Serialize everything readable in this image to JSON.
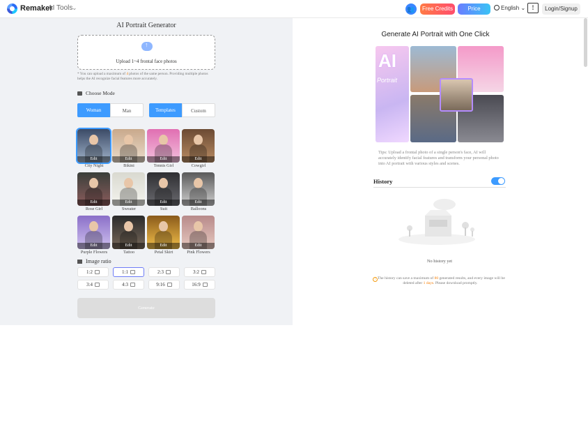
{
  "header": {
    "brand": "Remaker",
    "ai_tools": "AI Tools",
    "free_credits": "Free Credits",
    "price": "Price",
    "language": "English",
    "login": "Login/Signup"
  },
  "left": {
    "title": "AI Portrait Generator",
    "upload_text": "Upload 1~4 frontal face photos",
    "upload_note_prefix": "* You can upload a maximum of ",
    "upload_note_count": "4",
    "upload_note_suffix": " photos of the same person. Providing multiple photos helps the AI recognize facial features more accurately.",
    "choose_mode": "Choose Mode",
    "gender": [
      "Woman",
      "Man"
    ],
    "source": [
      "Templates",
      "Custom"
    ],
    "edit_label": "Edit",
    "templates": [
      {
        "label": "City Night",
        "colors": [
          "#3b4a66",
          "#9fb2c9"
        ]
      },
      {
        "label": "Bikini",
        "colors": [
          "#c9a98c",
          "#eadccb"
        ]
      },
      {
        "label": "Tennis Girl",
        "colors": [
          "#e06fb2",
          "#f3c1dd"
        ]
      },
      {
        "label": "Cowgirl",
        "colors": [
          "#6b4a33",
          "#b98c64"
        ]
      },
      {
        "label": "Rose Girl",
        "colors": [
          "#3a3f3a",
          "#8c5c5c"
        ]
      },
      {
        "label": "Sweater",
        "colors": [
          "#d9d9d0",
          "#f4f4ee"
        ]
      },
      {
        "label": "Suit",
        "colors": [
          "#2e2e32",
          "#6b6b70"
        ]
      },
      {
        "label": "Balloons",
        "colors": [
          "#5a5a5a",
          "#cfcfcf"
        ]
      },
      {
        "label": "Purple Flowers",
        "colors": [
          "#8a6fc8",
          "#d0c2ef"
        ]
      },
      {
        "label": "Tattoo",
        "colors": [
          "#2a2a2a",
          "#7a6a5a"
        ]
      },
      {
        "label": "Petal Skirt",
        "colors": [
          "#8a5a1a",
          "#f2c04a"
        ]
      },
      {
        "label": "Pink Flowers",
        "colors": [
          "#b78a8a",
          "#e8c9c0"
        ]
      }
    ],
    "image_ratio": "Image ratio",
    "ratios": [
      "1:2",
      "1:1",
      "2:3",
      "3:2",
      "3:4",
      "4:3",
      "9:16",
      "16:9"
    ],
    "selected_ratio": "1:1",
    "generate": "Generate"
  },
  "right": {
    "title": "Generate AI Portrait with One Click",
    "collage_ai": "AI",
    "collage_portrait": "Portrait",
    "tips": "Tips: Upload a frontal photo of a single person's face, AI will accurately identify facial features and transform your personal photo into AI portrait with various styles and scenes.",
    "history": "History",
    "no_history": "No history yet",
    "note_part1": "The history can save a maximum of ",
    "note_count": "80",
    "note_part2": " generated results, and every image will be deleted after ",
    "note_days": "1 days",
    "note_part3": ". Please download promptly."
  },
  "colors": {
    "accent": "#3d9bff",
    "panel_bg": "#f0f2f5"
  }
}
